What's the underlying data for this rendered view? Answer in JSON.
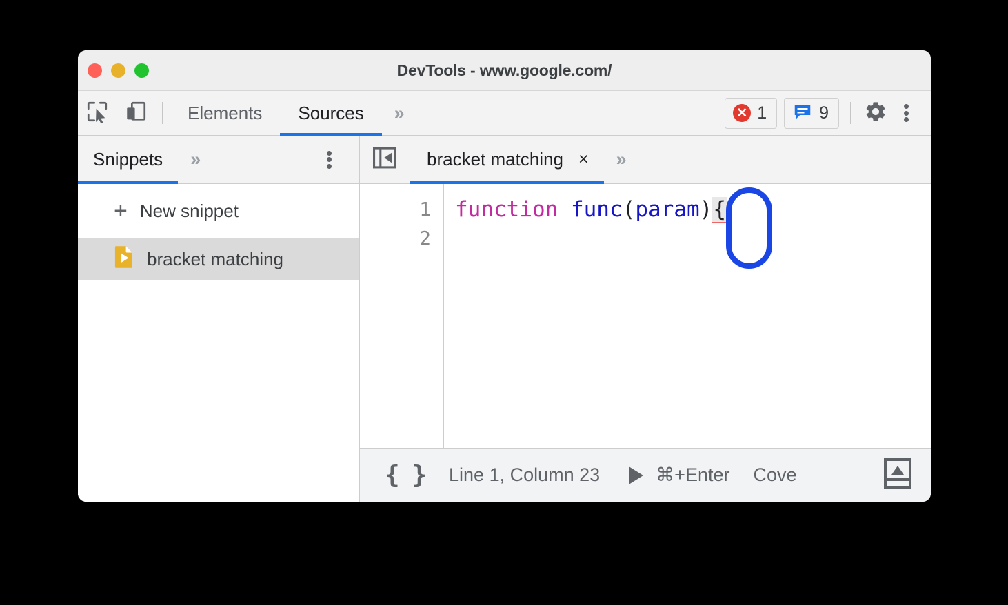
{
  "window": {
    "title": "DevTools - www.google.com/",
    "traffic_lights": [
      "close",
      "minimize",
      "maximize"
    ]
  },
  "toolbar": {
    "inspect_icon": "inspect-element-icon",
    "device_icon": "device-toolbar-icon",
    "tabs": [
      {
        "label": "Elements",
        "active": false
      },
      {
        "label": "Sources",
        "active": true
      }
    ],
    "more_tabs_icon": "chevron-double-right-icon",
    "error_count": "1",
    "message_count": "9",
    "settings_icon": "gear-icon",
    "more_icon": "kebab-menu-icon"
  },
  "sidebar": {
    "tabs": [
      {
        "label": "Snippets",
        "active": true
      }
    ],
    "more_tabs_icon": "chevron-double-right-icon",
    "more_icon": "kebab-menu-icon",
    "new_snippet_label": "New snippet",
    "plus_glyph": "+",
    "items": [
      {
        "label": "bracket matching",
        "icon": "snippet-file-icon",
        "selected": true
      }
    ]
  },
  "editor": {
    "collapse_icon": "collapse-sidebar-icon",
    "tabs": [
      {
        "label": "bracket matching",
        "active": true,
        "close_glyph": "×"
      }
    ],
    "more_tabs_icon": "chevron-double-right-icon",
    "line_numbers": [
      "1",
      "2"
    ],
    "code": {
      "keyword": "function",
      "space1": " ",
      "fn_name": "func",
      "paren_open": "(",
      "param": "param",
      "paren_close": ")",
      "brace": "{"
    }
  },
  "statusbar": {
    "pretty_print_icon": "{ }",
    "cursor_position": "Line 1, Column 23",
    "run_icon": "play-icon",
    "run_shortcut": "⌘+Enter",
    "coverage_label": "Cove",
    "drawer_icon": "drawer-toggle-icon"
  },
  "annotation": {
    "type": "highlight-rounded-rect",
    "color": "#1a46e5",
    "target": "open-brace"
  },
  "colors": {
    "accent": "#1a73e8",
    "error": "#e2392f",
    "message": "#1a73e8",
    "keyword": "#c32ba0",
    "identifier": "#1616c7",
    "snippet_icon": "#e8b22b",
    "annotation": "#1a46e5"
  }
}
